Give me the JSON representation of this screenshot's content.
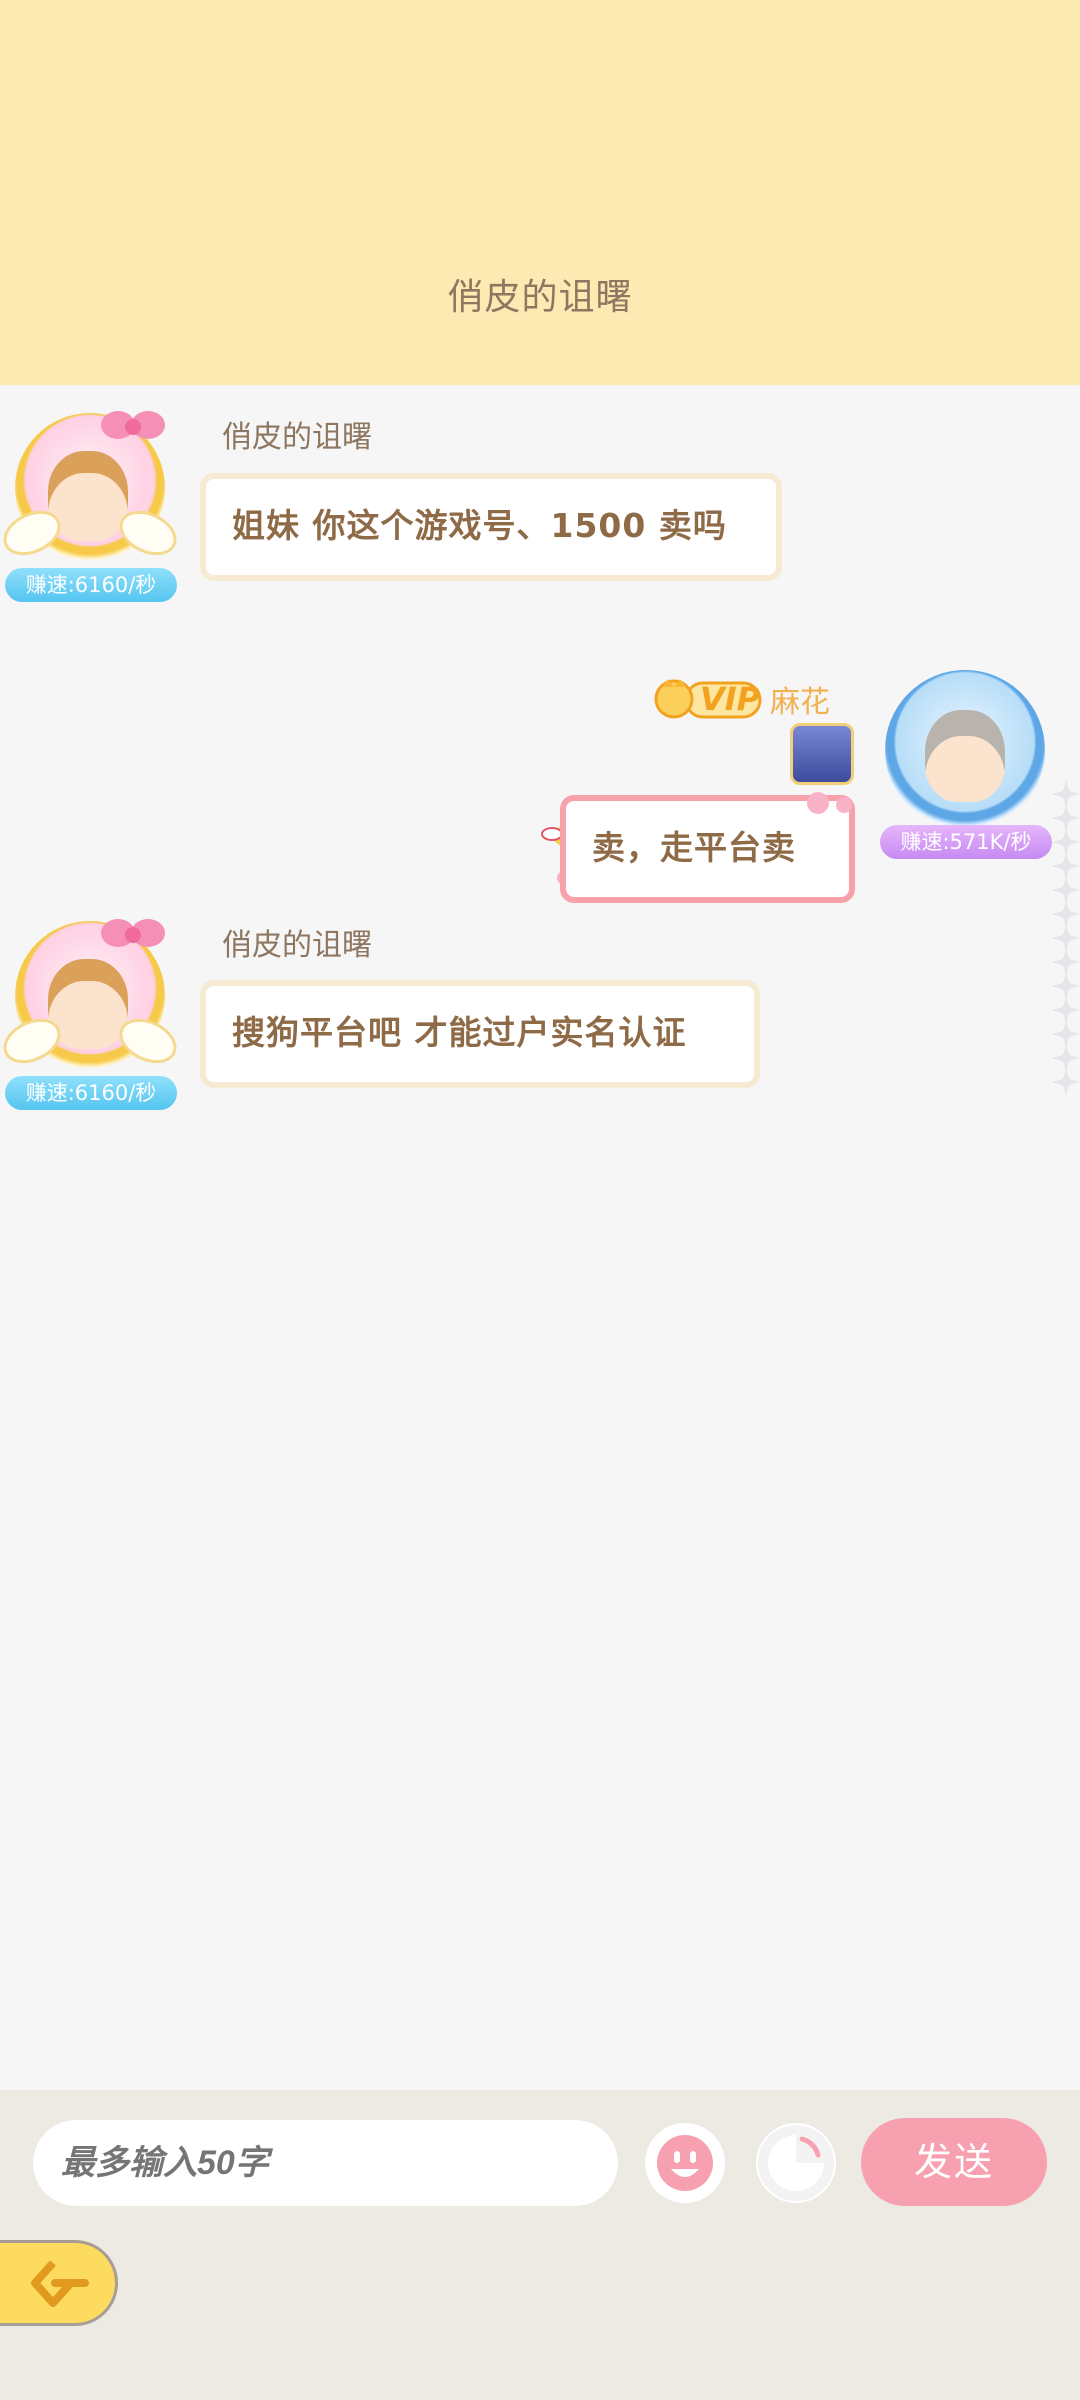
{
  "header": {
    "title": "俏皮的诅曙"
  },
  "messages": [
    {
      "sender": "俏皮的诅曙",
      "speed": "赚速:6160/秒",
      "text": "姐妹 你这个游戏号、1500 卖吗"
    },
    {
      "sender": "麻花",
      "vip": "VIP",
      "speed": "赚速:571K/秒",
      "text": "卖，走平台卖"
    },
    {
      "sender": "俏皮的诅曙",
      "speed": "赚速:6160/秒",
      "text": "搜狗平台吧 才能过户实名认证"
    }
  ],
  "composer": {
    "placeholder": "最多输入50字",
    "send_label": "发送"
  },
  "colors": {
    "header_bg": "#fde9b2",
    "send": "#f7a1b0",
    "back": "#fddb5e"
  },
  "icons": [
    "emoji-icon",
    "speech-bubble-icon",
    "back-arrow-icon",
    "vip-crown-icon",
    "magic-wand-icon",
    "bow-icon"
  ]
}
